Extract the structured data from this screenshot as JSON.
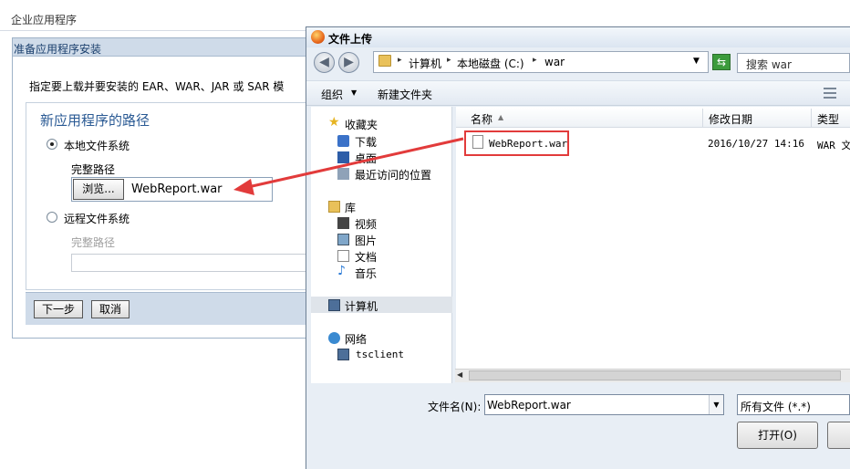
{
  "background_page": {
    "title": "企业应用程序",
    "panel_header": "准备应用程序安装",
    "instruction": "指定要上载并要安装的 EAR、WAR、JAR 或 SAR 模",
    "path_section_title": "新应用程序的路径",
    "local_fs_label": "本地文件系统",
    "full_path_label": "完整路径",
    "browse_label": "浏览...",
    "path_value": "WebReport.war",
    "remote_fs_label": "远程文件系统",
    "remote_full_path_label": "完整路径",
    "next_label": "下一步",
    "cancel_label": "取消"
  },
  "dialog": {
    "title": "文件上传",
    "breadcrumbs": [
      "计算机",
      "本地磁盘 (C:)",
      "war"
    ],
    "search_placeholder": "搜索 war",
    "toolbar": {
      "organize": "组织",
      "new_folder": "新建文件夹"
    },
    "nav": {
      "favorites": "收藏夹",
      "downloads": "下载",
      "desktop": "桌面",
      "recent": "最近访问的位置",
      "libraries": "库",
      "videos": "视频",
      "pictures": "图片",
      "documents": "文档",
      "music": "音乐",
      "computer": "计算机",
      "network": "网络",
      "tsclient": "tsclient"
    },
    "columns": {
      "name": "名称",
      "modified": "修改日期",
      "type": "类型"
    },
    "files": [
      {
        "name": "WebReport.war",
        "modified": "2016/10/27 14:16",
        "type": "WAR 文"
      }
    ],
    "filename_label": "文件名(N):",
    "filename_value": "WebReport.war",
    "filetype_value": "所有文件 (*.*)",
    "open_label": "打开(O)"
  },
  "colors": {
    "highlight": "#e23b3b",
    "arrow": "#e23b3b",
    "panel_header_bg": "#cfdbe9",
    "section_title": "#2a5a94"
  }
}
